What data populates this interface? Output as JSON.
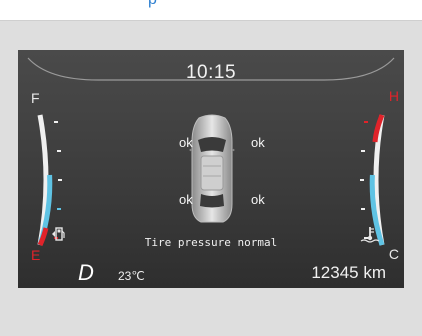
{
  "header": {
    "fragment": "p"
  },
  "cluster": {
    "time": "10:15",
    "fuel_gauge": {
      "full_label": "F",
      "empty_label": "E",
      "level": 0.45
    },
    "temp_gauge": {
      "hot_label": "H",
      "cold_label": "C",
      "level": 0.45
    },
    "tires": {
      "front_left": "ok",
      "front_right": "ok",
      "rear_left": "ok",
      "rear_right": "ok"
    },
    "status_text": "Tire pressure normal",
    "gear": "D",
    "outside_temp": "23℃",
    "odometer": "12345 km",
    "icons": {
      "fuel": "fuel-pump-icon",
      "coolant": "coolant-temperature-icon",
      "car": "car-top-view-icon"
    },
    "colors": {
      "accent_blue": "#5fc3e4",
      "warning_red": "#e0232a",
      "panel": "#3b3b3b"
    }
  }
}
